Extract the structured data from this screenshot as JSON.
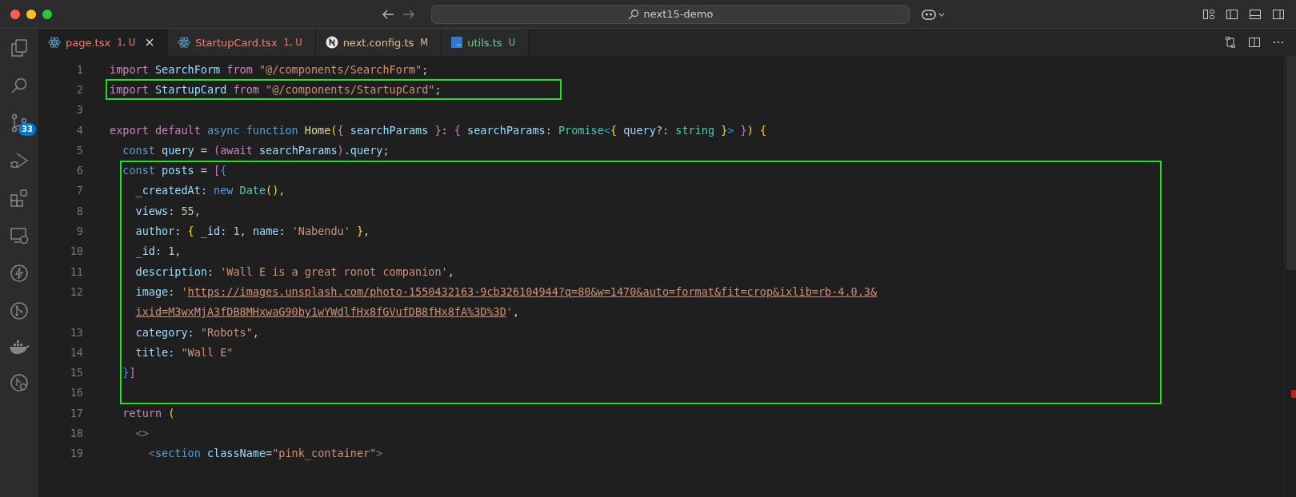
{
  "window": {
    "search": "next15-demo"
  },
  "activity_bar": {
    "badge": "33"
  },
  "tabs": [
    {
      "name": "page.tsx",
      "badge": "1, U",
      "color": "#f07f72",
      "kind": "react",
      "selected": true
    },
    {
      "name": "StartupCard.tsx",
      "badge": "1, U",
      "color": "#f07f72",
      "kind": "react",
      "selected": false
    },
    {
      "name": "next.config.ts",
      "badge": "M",
      "color": "#e2c08d",
      "kind": "next",
      "selected": false
    },
    {
      "name": "utils.ts",
      "badge": "U",
      "color": "#73c991",
      "kind": "ts",
      "selected": false
    }
  ],
  "editor": {
    "blocks": [
      {
        "kind": "plain",
        "lines": [
          {
            "kind": "code",
            "number": "1",
            "tokens": [
              {
                "t": "import",
                "kind": "kw"
              },
              {
                "t": " SearchForm",
                "kind": "var"
              },
              {
                "t": " from",
                "kind": "kw"
              },
              {
                "t": " \"@/components/SearchForm\"",
                "kind": "str"
              },
              {
                "t": ";",
                "kind": "p"
              }
            ]
          }
        ]
      },
      {
        "kind": "boxed_line",
        "lines": [
          {
            "kind": "code",
            "number": "2",
            "tokens": [
              {
                "t": "import",
                "kind": "kw"
              },
              {
                "t": " StartupCard",
                "kind": "var"
              },
              {
                "t": " from",
                "kind": "kw"
              },
              {
                "t": " \"@/components/StartupCard\"",
                "kind": "str"
              },
              {
                "t": ";",
                "kind": "p"
              }
            ]
          }
        ]
      },
      {
        "kind": "plain",
        "lines": [
          {
            "kind": "code",
            "number": "3"
          },
          {
            "kind": "code",
            "number": "4",
            "tokens": [
              {
                "t": "export default",
                "kind": "kw"
              },
              {
                "t": " async function",
                "kind": "st"
              },
              {
                "t": " Home",
                "kind": "fn"
              },
              {
                "t": "(",
                "kind": "b1"
              },
              {
                "t": "{",
                "kind": "b2"
              },
              {
                "t": " searchParams ",
                "kind": "var"
              },
              {
                "t": "}",
                "kind": "b2"
              },
              {
                "t": ": ",
                "kind": "p"
              },
              {
                "t": "{",
                "kind": "b2"
              },
              {
                "t": " searchParams",
                "kind": "var"
              },
              {
                "t": ": ",
                "kind": "p"
              },
              {
                "t": "Promise",
                "kind": "type"
              },
              {
                "t": "<",
                "kind": "b3"
              },
              {
                "t": "{",
                "kind": "b1"
              },
              {
                "t": " query",
                "kind": "var"
              },
              {
                "t": "?: ",
                "kind": "p"
              },
              {
                "t": "string",
                "kind": "type"
              },
              {
                "t": " }",
                "kind": "b1"
              },
              {
                "t": ">",
                "kind": "b3"
              },
              {
                "t": " }",
                "kind": "b2"
              },
              {
                "t": ")",
                "kind": "b1"
              },
              {
                "t": " {",
                "kind": "b1"
              }
            ]
          },
          {
            "kind": "code",
            "number": "5",
            "tokens": [
              {
                "t": "  const",
                "kind": "st"
              },
              {
                "t": " query",
                "kind": "var"
              },
              {
                "t": " = ",
                "kind": "p"
              },
              {
                "t": "(",
                "kind": "b2"
              },
              {
                "t": "await",
                "kind": "kw"
              },
              {
                "t": " searchParams",
                "kind": "var"
              },
              {
                "t": ")",
                "kind": "b2"
              },
              {
                "t": ".",
                "kind": "p"
              },
              {
                "t": "query",
                "kind": "var"
              },
              {
                "t": ";",
                "kind": "p"
              }
            ]
          }
        ]
      },
      {
        "kind": "boxed_block",
        "lines": [
          {
            "kind": "code",
            "number": "6",
            "tokens": [
              {
                "t": "  const",
                "kind": "st"
              },
              {
                "t": " posts",
                "kind": "var"
              },
              {
                "t": " = ",
                "kind": "p"
              },
              {
                "t": "[",
                "kind": "b2"
              },
              {
                "t": "{",
                "kind": "b3"
              }
            ]
          },
          {
            "kind": "code",
            "number": "7",
            "tokens": [
              {
                "t": "    _createdAt",
                "kind": "var"
              },
              {
                "t": ": ",
                "kind": "p"
              },
              {
                "t": "new",
                "kind": "st"
              },
              {
                "t": " Date",
                "kind": "type"
              },
              {
                "t": "()",
                "kind": "b1"
              },
              {
                "t": ",",
                "kind": "p"
              }
            ]
          },
          {
            "kind": "code",
            "number": "8",
            "tokens": [
              {
                "t": "    views",
                "kind": "var"
              },
              {
                "t": ": ",
                "kind": "p"
              },
              {
                "t": "55",
                "kind": "num"
              },
              {
                "t": ",",
                "kind": "p"
              }
            ]
          },
          {
            "kind": "code",
            "number": "9",
            "tokens": [
              {
                "t": "    author",
                "kind": "var"
              },
              {
                "t": ": ",
                "kind": "p"
              },
              {
                "t": "{",
                "kind": "b1"
              },
              {
                "t": " _id",
                "kind": "var"
              },
              {
                "t": ": ",
                "kind": "p"
              },
              {
                "t": "1",
                "kind": "num"
              },
              {
                "t": ",",
                "kind": "p"
              },
              {
                "t": " name",
                "kind": "var"
              },
              {
                "t": ": ",
                "kind": "p"
              },
              {
                "t": "'Nabendu'",
                "kind": "str"
              },
              {
                "t": " }",
                "kind": "b1"
              },
              {
                "t": ",",
                "kind": "p"
              }
            ]
          },
          {
            "kind": "code",
            "number": "10",
            "tokens": [
              {
                "t": "    _id",
                "kind": "var"
              },
              {
                "t": ": ",
                "kind": "p"
              },
              {
                "t": "1",
                "kind": "num"
              },
              {
                "t": ",",
                "kind": "p"
              }
            ]
          },
          {
            "kind": "code",
            "number": "11",
            "tokens": [
              {
                "t": "    description",
                "kind": "var"
              },
              {
                "t": ": ",
                "kind": "p"
              },
              {
                "t": "'Wall E is a great ronot companion'",
                "kind": "str"
              },
              {
                "t": ",",
                "kind": "p"
              }
            ]
          },
          {
            "kind": "code",
            "number": "12",
            "tokens": [
              {
                "t": "    image",
                "kind": "var"
              },
              {
                "t": ": ",
                "kind": "p"
              },
              {
                "t": "'",
                "kind": "str"
              },
              {
                "t": "https://images.unsplash.com/photo-1550432163-9cb326104944?q=80&w=1470&auto=format&fit=crop&ixlib=rb-4.0.3&",
                "kind": "link"
              }
            ]
          },
          {
            "kind": "wrap",
            "tokens": [
              {
                "t": "ixid=M3wxMjA3fDB8MHxwaG90by1wYWdlfHx8fGVufDB8fHx8fA%3D%3D",
                "kind": "link"
              },
              {
                "t": "'",
                "kind": "str"
              },
              {
                "t": ",",
                "kind": "p"
              }
            ]
          },
          {
            "kind": "code",
            "number": "13",
            "tokens": [
              {
                "t": "    category",
                "kind": "var"
              },
              {
                "t": ": ",
                "kind": "p"
              },
              {
                "t": "\"Robots\"",
                "kind": "str"
              },
              {
                "t": ",",
                "kind": "p"
              }
            ]
          },
          {
            "kind": "code",
            "number": "14",
            "tokens": [
              {
                "t": "    title",
                "kind": "var"
              },
              {
                "t": ": ",
                "kind": "p"
              },
              {
                "t": "\"Wall E\"",
                "kind": "str"
              }
            ]
          },
          {
            "kind": "code",
            "number": "15",
            "tokens": [
              {
                "t": "  }",
                "kind": "b3"
              },
              {
                "t": "]",
                "kind": "b2"
              }
            ]
          },
          {
            "kind": "code",
            "number": "16"
          }
        ]
      },
      {
        "kind": "plain",
        "lines": [
          {
            "kind": "code",
            "number": "17",
            "tokens": [
              {
                "t": "  return",
                "kind": "kw"
              },
              {
                "t": " (",
                "kind": "b1"
              }
            ]
          },
          {
            "kind": "code",
            "number": "18",
            "tokens": [
              {
                "t": "    <>",
                "kind": "tagp"
              }
            ]
          },
          {
            "kind": "code",
            "number": "19",
            "tokens": [
              {
                "t": "      <",
                "kind": "tagp"
              },
              {
                "t": "section",
                "kind": "tag"
              },
              {
                "t": " className",
                "kind": "attr"
              },
              {
                "t": "=",
                "kind": "p"
              },
              {
                "t": "\"pink_container\"",
                "kind": "str"
              },
              {
                "t": ">",
                "kind": "tagp"
              }
            ]
          }
        ]
      }
    ]
  }
}
